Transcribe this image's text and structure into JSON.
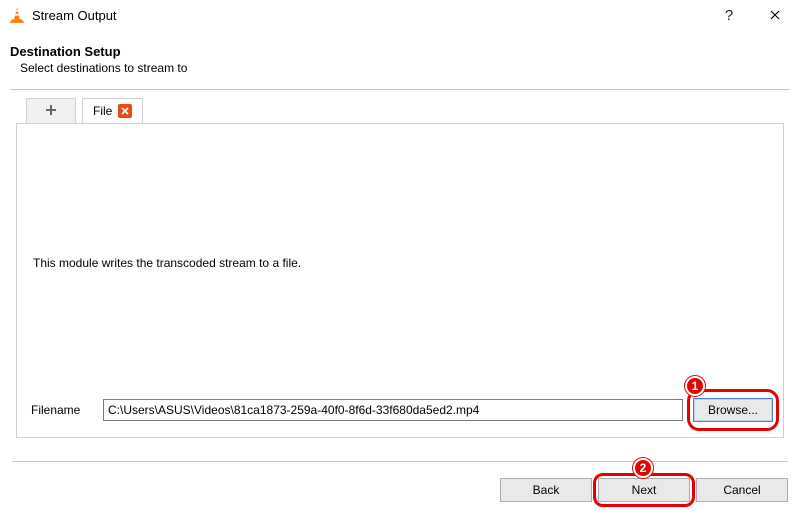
{
  "window": {
    "title": "Stream Output"
  },
  "header": {
    "title": "Destination Setup",
    "subtitle": "Select destinations to stream to"
  },
  "tabs": {
    "file_label": "File"
  },
  "pane": {
    "module_text": "This module writes the transcoded stream to a file.",
    "filename_label": "Filename",
    "filename_value": "C:\\Users\\ASUS\\Videos\\81ca1873-259a-40f0-8f6d-33f680da5ed2.mp4",
    "browse_label": "Browse..."
  },
  "footer": {
    "back_label": "Back",
    "next_label": "Next",
    "cancel_label": "Cancel"
  },
  "annotations": {
    "badge1": "1",
    "badge2": "2"
  }
}
